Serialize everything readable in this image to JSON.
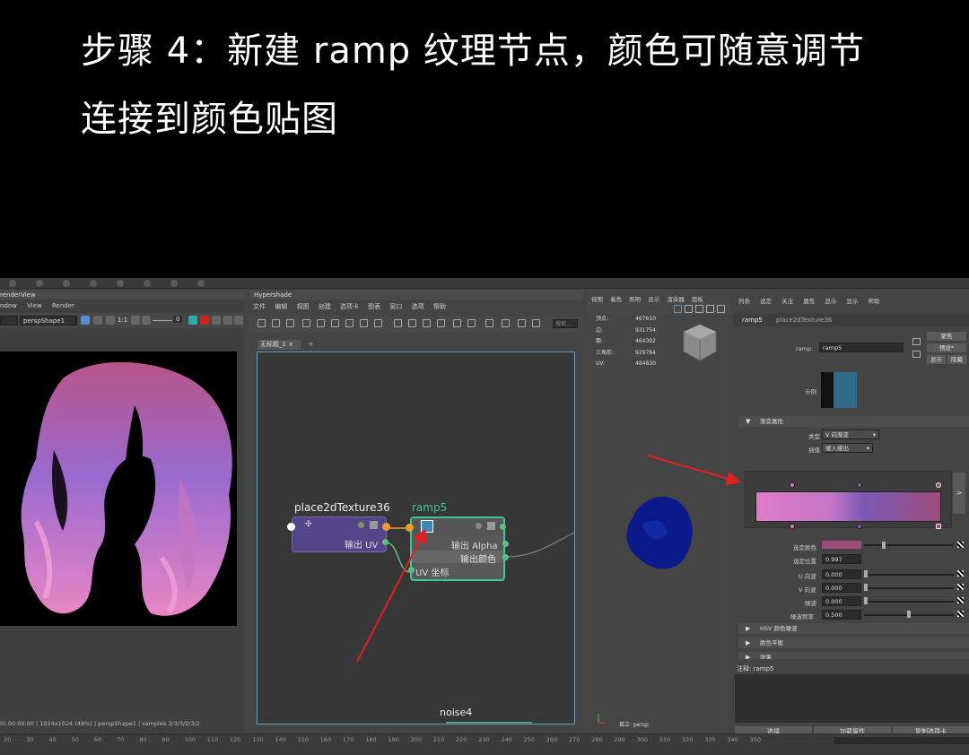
{
  "banner": {
    "line1": "步骤 4：新建 ramp 纹理节点，颜色可随意调节",
    "line2": "连接到颜色贴图"
  },
  "render_view": {
    "title": "renderView",
    "menu": [
      "ndow",
      "View",
      "Render"
    ],
    "camera": "perspShape1",
    "ratio": "1:1",
    "value": "0",
    "status": "0) 00:00:00 | 1024x1024 (49%) | perspShape1 | samples 3/3/3/2/3/2"
  },
  "hypershade": {
    "title": "Hypershade",
    "menu": [
      "文件",
      "编辑",
      "视图",
      "创建",
      "选项卡",
      "图表",
      "窗口",
      "选项",
      "帮助"
    ],
    "search_placeholder": "搜索...",
    "tab": "无标题_1",
    "nodes": {
      "place2d": {
        "name": "place2dTexture36",
        "port": "输出 UV"
      },
      "ramp": {
        "name": "ramp5",
        "ports": [
          "输出 Alpha",
          "输出颜色",
          "UV 坐标"
        ]
      },
      "noise": {
        "name": "noise4"
      }
    }
  },
  "viewport": {
    "menu": [
      "视图",
      "着色",
      "照明",
      "显示",
      "渲染器",
      "面板"
    ],
    "stats": [
      {
        "label": "顶点:",
        "value": "467610"
      },
      {
        "label": "边:",
        "value": "931754"
      },
      {
        "label": "面:",
        "value": "464392"
      },
      {
        "label": "三角形:",
        "value": "929784"
      },
      {
        "label": "UV:",
        "value": "484830"
      }
    ],
    "camera_label": "孤立: persp"
  },
  "attribute_editor": {
    "menu": [
      "列表",
      "选定",
      "关注",
      "属性",
      "显示",
      "显示",
      "帮助"
    ],
    "tabs": [
      "ramp5",
      "place2dTexture36"
    ],
    "node_label": "ramp:",
    "node_value": "ramp5",
    "buttons": [
      "聚焦",
      "预设*",
      "显示",
      "隐藏"
    ],
    "sample_label": "示例",
    "section_ramp": "渐变属性",
    "type_label": "类型",
    "type_value": "V 向渐变",
    "interp_label": "插值",
    "interp_value": "缓入缓出",
    "selected_color_label": "选定颜色",
    "selected_pos_label": "选定位置",
    "selected_pos_value": "0.997",
    "u_wave_label": "U 向波",
    "u_wave_value": "0.000",
    "v_wave_label": "V 向波",
    "v_wave_value": "0.000",
    "noise_label": "噪波",
    "noise_value": "0.000",
    "noise_freq_label": "噪波频率",
    "noise_freq_value": "0.500",
    "section_hsv": "HSV 颜色噪波",
    "section_balance": "颜色平衡",
    "section_effects": "效果",
    "notes": "注释: ramp5",
    "bottom_buttons": [
      "选择",
      "加载属性",
      "复制选项卡"
    ],
    "side_button": ">"
  },
  "timeline": {
    "ticks": [
      "20",
      "30",
      "40",
      "50",
      "60",
      "70",
      "80",
      "90",
      "100",
      "110",
      "120",
      "130",
      "140",
      "150",
      "160",
      "170",
      "180",
      "190",
      "200",
      "210",
      "220",
      "230",
      "240",
      "250",
      "260",
      "270",
      "280",
      "290",
      "300",
      "310",
      "320",
      "330",
      "340",
      "350"
    ]
  },
  "colors": {
    "ramp_gradient": [
      "#e07ac8",
      "#7c5ab8",
      "#9c4c7a"
    ],
    "node_accent": "#3fc49c",
    "annotation_arrow": "#e02020",
    "place2d_node": "#55448a"
  }
}
